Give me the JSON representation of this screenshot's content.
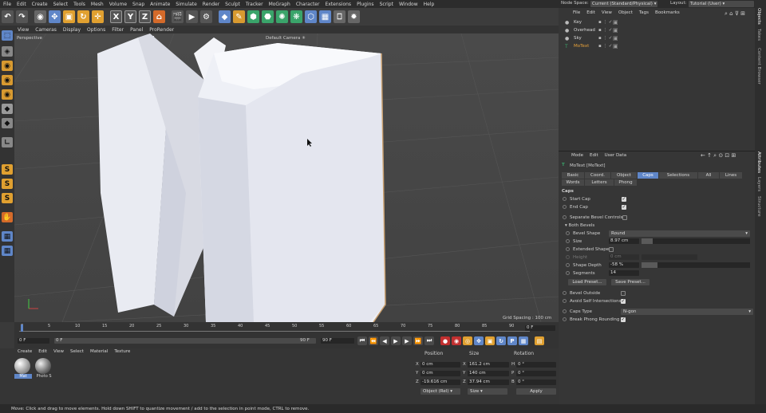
{
  "menubar": [
    "File",
    "Edit",
    "Create",
    "Select",
    "Tools",
    "Mesh",
    "Volume",
    "Snap",
    "Animate",
    "Simulate",
    "Render",
    "Sculpt",
    "Tracker",
    "MoGraph",
    "Character",
    "Extensions",
    "Plugins",
    "Script",
    "Window",
    "Help"
  ],
  "toolbar": {
    "axis_x": "X",
    "axis_y": "Y",
    "axis_z": "Z"
  },
  "viewport_menu": [
    "View",
    "Cameras",
    "Display",
    "Options",
    "Filter",
    "Panel",
    "ProRender"
  ],
  "viewport": {
    "name": "Perspective",
    "camera": "Default Camera ✳",
    "grid_spacing": "Grid Spacing : 100 cm"
  },
  "left_tools": {
    "s1": "S",
    "s2": "S",
    "s3": "S"
  },
  "timeline": {
    "ticks": [
      "0",
      "5",
      "10",
      "15",
      "20",
      "25",
      "30",
      "35",
      "40",
      "45",
      "50",
      "55",
      "60",
      "65",
      "70",
      "75",
      "80",
      "85",
      "90"
    ],
    "current_frame": "0 F",
    "start": "0 F",
    "start2": "0 F",
    "end": "90 F",
    "end2": "90 F"
  },
  "material_manager": {
    "menu": [
      "Create",
      "Edit",
      "View",
      "Select",
      "Material",
      "Texture"
    ],
    "materials": [
      {
        "name": "Mat"
      },
      {
        "name": "Photo S"
      }
    ]
  },
  "coords": {
    "headers": {
      "position": "Position",
      "size": "Size",
      "rotation": "Rotation"
    },
    "rows": [
      {
        "axis": "X",
        "pos": "0 cm",
        "saxis": "X",
        "size": "161.2 cm",
        "raxis": "H",
        "rot": "0 °"
      },
      {
        "axis": "Y",
        "pos": "0 cm",
        "saxis": "Y",
        "size": "140 cm",
        "raxis": "P",
        "rot": "0 °"
      },
      {
        "axis": "Z",
        "pos": "-19.616 cm",
        "saxis": "Z",
        "size": "37.94 cm",
        "raxis": "B",
        "rot": "0 °"
      }
    ],
    "mode": "Object (Rel)",
    "size_mode": "Size",
    "apply": "Apply"
  },
  "status": "Move: Click and drag to move elements. Hold down SHIFT to quantize movement / add to the selection in point mode, CTRL to remove.",
  "right_header": {
    "node_space_label": "Node Space:",
    "node_space_value": "Current (Standard/Physical)",
    "layout_label": "Layout:",
    "layout_value": "Tutorial (User)"
  },
  "object_manager": {
    "menu": [
      "File",
      "Edit",
      "View",
      "Object",
      "Tags",
      "Bookmarks"
    ],
    "objects": [
      {
        "name": "Key",
        "color": "#d8d8d8"
      },
      {
        "name": "Overhead",
        "color": "#d8d8d8"
      },
      {
        "name": "Sky",
        "color": "#d8d8d8"
      },
      {
        "name": "MoText",
        "color": "#e8a23a"
      }
    ]
  },
  "attributes": {
    "menu": [
      "Mode",
      "Edit",
      "User Data"
    ],
    "object_title": "MoText [MoText]",
    "tabs_row1": [
      "Basic",
      "Coord.",
      "Object",
      "Caps",
      "Selections",
      "All",
      "Lines"
    ],
    "tabs_row2": [
      "Words",
      "Letters",
      "Phong"
    ],
    "active_tab": "Caps",
    "section": "Caps",
    "start_cap": "Start Cap",
    "end_cap": "End Cap",
    "separate_bevel": "Separate Bevel Controls",
    "both_bevels": "Both Bevels",
    "bevel_shape_label": "Bevel Shape",
    "bevel_shape_value": "Round",
    "size_label": "Size",
    "size_value": "8.97 cm",
    "size_fraction": 0.1,
    "extended_shape": "Extended Shape",
    "height_label": "Height",
    "height_value": "0 cm",
    "shape_depth_label": "Shape Depth",
    "shape_depth_value": "-58 %",
    "shape_depth_fraction": 0.15,
    "segments_label": "Segments",
    "segments_value": "14",
    "load_preset": "Load Preset...",
    "save_preset": "Save Preset...",
    "bevel_outside": "Bevel Outside",
    "avoid_self": "Avoid Self Intersections",
    "caps_type_label": "Caps Type",
    "caps_type_value": "N-gon",
    "break_phong": "Break Phong Rounding"
  },
  "right_strip": [
    "Objects",
    "Takes",
    "Content Browser",
    "Attributes",
    "Layers",
    "Structure"
  ]
}
